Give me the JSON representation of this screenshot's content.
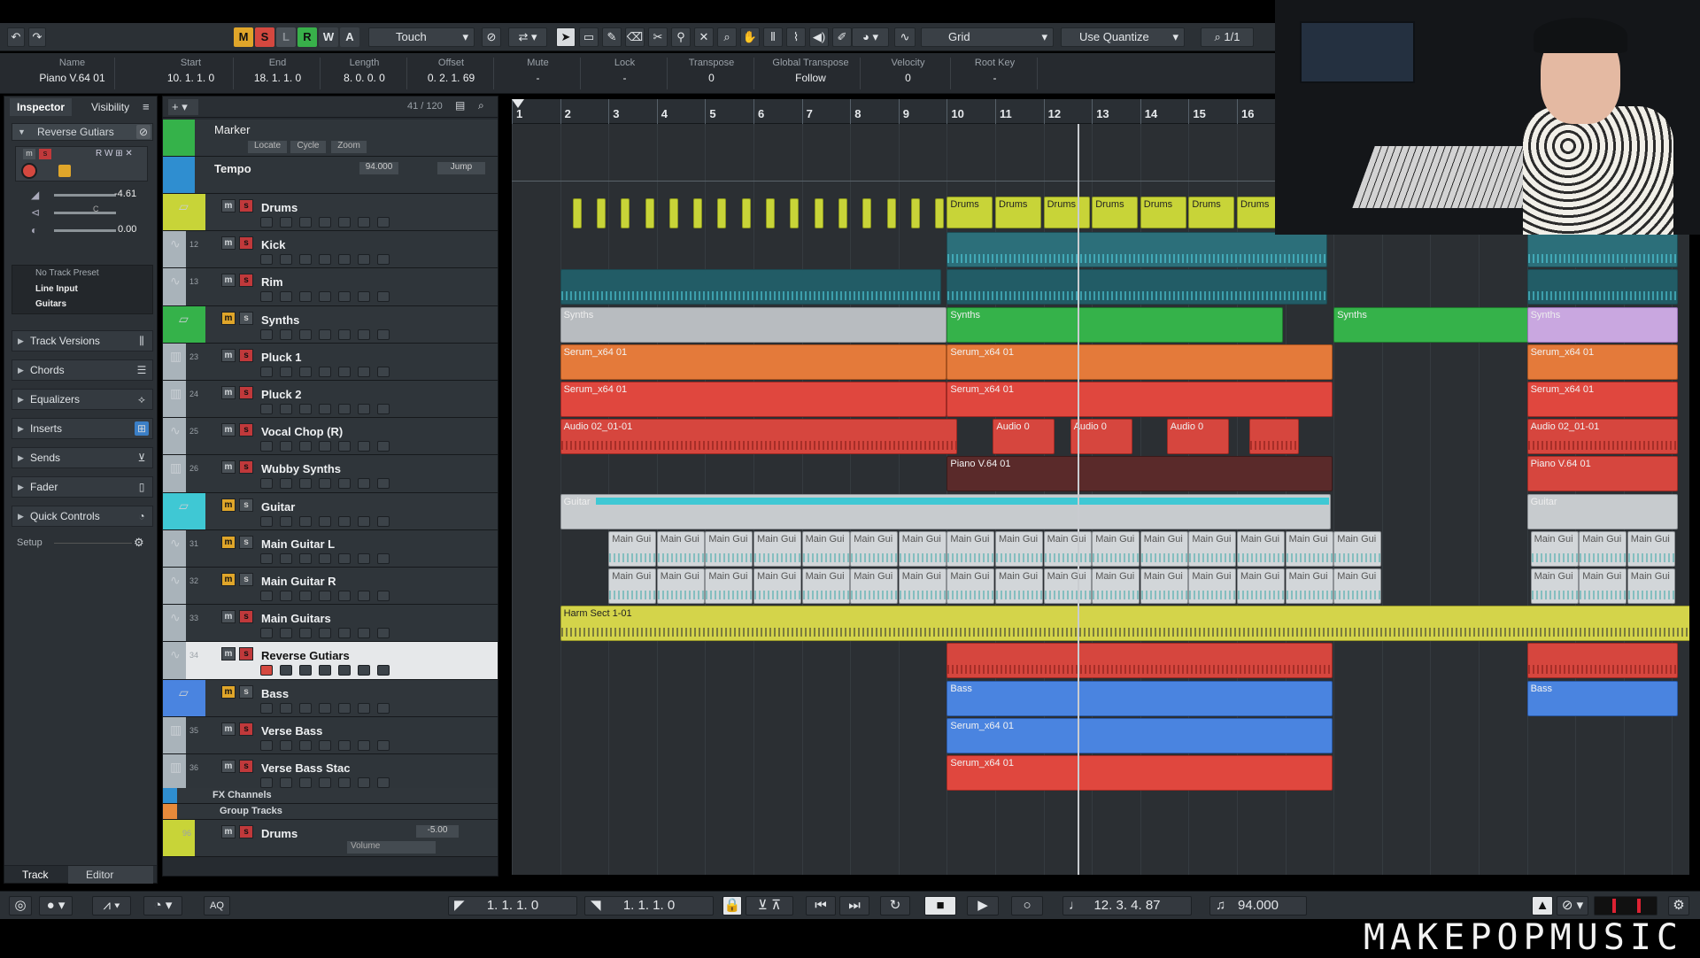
{
  "toolbar": {
    "m": "M",
    "s": "S",
    "l": "L",
    "r": "R",
    "w": "W",
    "a": "A",
    "automation": "Touch",
    "snap": "Grid",
    "quantize": "Use Quantize",
    "quant_val": "1/1"
  },
  "info": [
    {
      "h": "Name",
      "v": "Piano V.64 01"
    },
    {
      "h": "Start",
      "v": "10. 1. 1.    0"
    },
    {
      "h": "End",
      "v": "18. 1. 1.    0"
    },
    {
      "h": "Length",
      "v": "8. 0. 0.    0"
    },
    {
      "h": "Offset",
      "v": "0. 2. 1. 69"
    },
    {
      "h": "Mute",
      "v": "-"
    },
    {
      "h": "Lock",
      "v": "-"
    },
    {
      "h": "Transpose",
      "v": "0"
    },
    {
      "h": "Global Transpose",
      "v": "Follow"
    },
    {
      "h": "Velocity",
      "v": "0"
    },
    {
      "h": "Root Key",
      "v": "-"
    }
  ],
  "inspector": {
    "tab1": "Inspector",
    "tab2": "Visibility",
    "track": "Reverse Gutiars",
    "vol": "-4.61",
    "pan": "C",
    "delay": "0.00",
    "preset": "No Track Preset",
    "input": "Line Input",
    "output": "Guitars",
    "sections": [
      "Track Versions",
      "Chords",
      "Equalizers",
      "Inserts",
      "Sends",
      "Fader",
      "Quick Controls"
    ],
    "setup": "Setup",
    "btab1": "Track",
    "btab2": "Editor"
  },
  "tracklist": {
    "count": "41 / 120",
    "marker": "Marker",
    "locate": "Locate",
    "cycle": "Cycle",
    "zoom": "Zoom",
    "tempo": "Tempo",
    "tempo_val": "94.000",
    "jump": "Jump",
    "tracks": [
      {
        "n": "",
        "name": "Drums"
      },
      {
        "n": "12",
        "name": "Kick"
      },
      {
        "n": "13",
        "name": "Rim"
      },
      {
        "n": "",
        "name": "Synths"
      },
      {
        "n": "23",
        "name": "Pluck 1"
      },
      {
        "n": "24",
        "name": "Pluck 2"
      },
      {
        "n": "25",
        "name": "Vocal  Chop (R)"
      },
      {
        "n": "26",
        "name": "Wubby Synths"
      },
      {
        "n": "",
        "name": "Guitar"
      },
      {
        "n": "31",
        "name": "Main Guitar L"
      },
      {
        "n": "32",
        "name": "Main Guitar R"
      },
      {
        "n": "33",
        "name": "Main Guitars"
      },
      {
        "n": "34",
        "name": "Reverse Gutiars"
      },
      {
        "n": "",
        "name": "Bass"
      },
      {
        "n": "35",
        "name": "Verse Bass"
      },
      {
        "n": "36",
        "name": "Verse Bass Stac"
      }
    ],
    "fx": "FX Channels",
    "group": "Group Tracks",
    "gnum": "96",
    "gname": "Drums",
    "gvol": "-5.00",
    "gparam": "Volume"
  },
  "ruler": [
    "1",
    "2",
    "3",
    "4",
    "5",
    "6",
    "7",
    "8",
    "9",
    "10",
    "11",
    "12",
    "13",
    "14",
    "15",
    "16"
  ],
  "events": {
    "drums": "Drums",
    "synths": "Synths",
    "serum": "Serum_x64 01",
    "audio": "Audio 02_01-01",
    "audio0": "Audio 0",
    "piano": "Piano V.64 01",
    "guitar": "Guitar",
    "mg": "Main Gui",
    "harm": "Harm Sect 1-01",
    "bass": "Bass"
  },
  "transport": {
    "left": "1. 1. 1.    0",
    "right": "1. 1. 1.    0",
    "pos": "12. 3. 4. 87",
    "tempo": "94.000"
  },
  "brand": "MAKEPOPMUSIC"
}
